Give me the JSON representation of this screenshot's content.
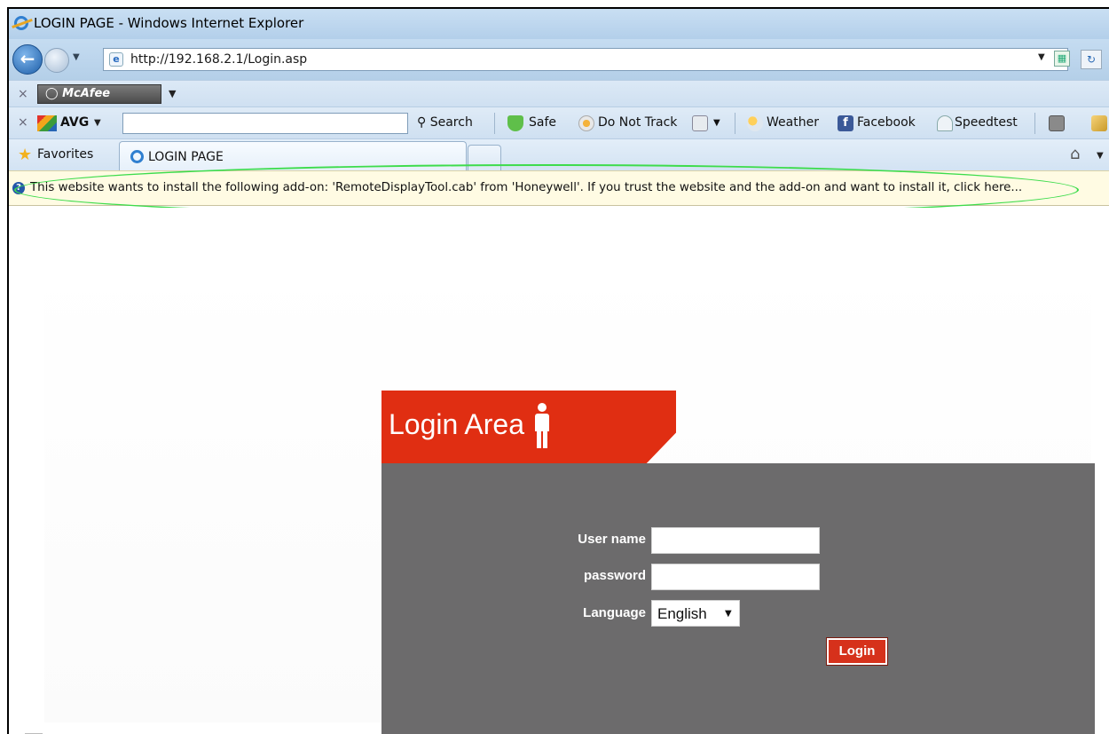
{
  "window": {
    "title": "LOGIN PAGE - Windows Internet Explorer"
  },
  "address_bar": {
    "url": "http://192.168.2.1/Login.asp"
  },
  "mcafee_toolbar": {
    "label": "McAfee"
  },
  "avg_toolbar": {
    "brand": "AVG",
    "search_value": "",
    "items": {
      "search": "Search",
      "safe": "Safe",
      "do_not_track": "Do Not Track",
      "weather": "Weather",
      "facebook": "Facebook",
      "speedtest": "Speedtest"
    }
  },
  "favorites_bar": {
    "favorites_label": "Favorites",
    "active_tab_title": "LOGIN PAGE"
  },
  "info_bar": {
    "message": "This website wants to install the following add-on: 'RemoteDisplayTool.cab' from 'Honeywell'. If you trust the website and the add-on and want to install it, click here..."
  },
  "login": {
    "header": "Login Area",
    "username_label": "User name",
    "username_value": "",
    "password_label": "password",
    "password_value": "",
    "language_label": "Language",
    "language_selected": "English",
    "login_button": "Login"
  },
  "colors": {
    "login_header_red": "#e02e12",
    "login_panel_gray": "#6c6b6c",
    "highlight_green": "#3ddc4c",
    "info_bar_bg": "#fffbe3"
  }
}
